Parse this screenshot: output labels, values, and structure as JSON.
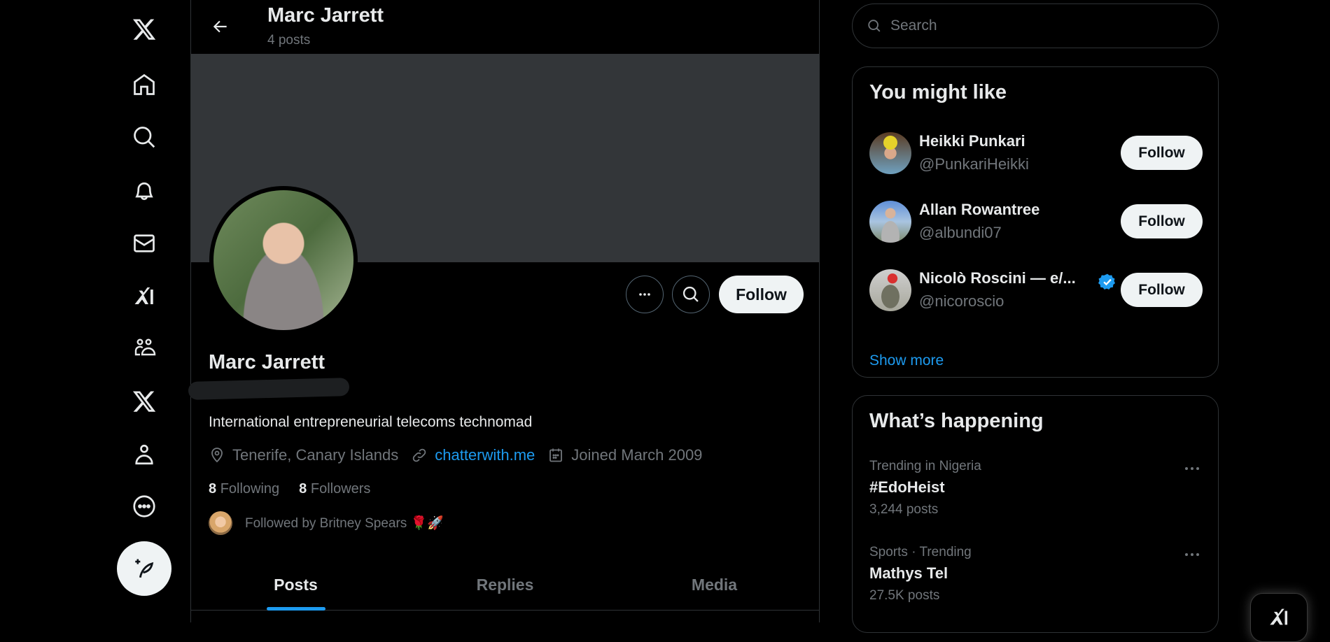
{
  "nav": {
    "items": [
      {
        "name": "x-logo",
        "label": "X"
      },
      {
        "name": "home",
        "label": "Home"
      },
      {
        "name": "explore",
        "label": "Explore"
      },
      {
        "name": "notifications",
        "label": "Notifications"
      },
      {
        "name": "messages",
        "label": "Messages"
      },
      {
        "name": "grok",
        "label": "Grok"
      },
      {
        "name": "communities",
        "label": "Communities"
      },
      {
        "name": "premium",
        "label": "Premium"
      },
      {
        "name": "profile",
        "label": "Profile"
      },
      {
        "name": "more",
        "label": "More"
      }
    ],
    "compose_label": "Post"
  },
  "header": {
    "title": "Marc Jarrett",
    "subtitle": "4 posts"
  },
  "profile": {
    "name": "Marc Jarrett",
    "bio": "International entrepreneurial telecoms technomad",
    "location": "Tenerife, Canary Islands",
    "website": "chatterwith.me",
    "joined": "Joined March 2009",
    "following_count": "8",
    "following_label": "Following",
    "followers_count": "8",
    "followers_label": "Followers",
    "followed_by": "Followed by Britney Spears 🌹🚀",
    "follow_label": "Follow"
  },
  "tabs": [
    {
      "label": "Posts",
      "active": true
    },
    {
      "label": "Replies",
      "active": false
    },
    {
      "label": "Media",
      "active": false
    }
  ],
  "search": {
    "placeholder": "Search"
  },
  "you_might_like": {
    "title": "You might like",
    "users": [
      {
        "name": "Heikki Punkari",
        "handle": "@PunkariHeikki",
        "verified": false,
        "follow_label": "Follow"
      },
      {
        "name": "Allan Rowantree",
        "handle": "@albundi07",
        "verified": false,
        "follow_label": "Follow"
      },
      {
        "name": "Nicolò Roscini — e/...",
        "handle": "@nicoroscio",
        "verified": true,
        "follow_label": "Follow"
      }
    ],
    "show_more": "Show more"
  },
  "whats_happening": {
    "title": "What’s happening",
    "trends": [
      {
        "context": "Trending in Nigeria",
        "topic": "#EdoHeist",
        "count": "3,244 posts"
      },
      {
        "context": "Sports · Trending",
        "topic": "Mathys Tel",
        "count": "27.5K posts"
      }
    ]
  },
  "colors": {
    "accent": "#1d9bf0",
    "background": "#000000",
    "banner": "#333639",
    "border": "#2f3336",
    "text_primary": "#e7e9ea",
    "text_secondary": "#71767b"
  }
}
